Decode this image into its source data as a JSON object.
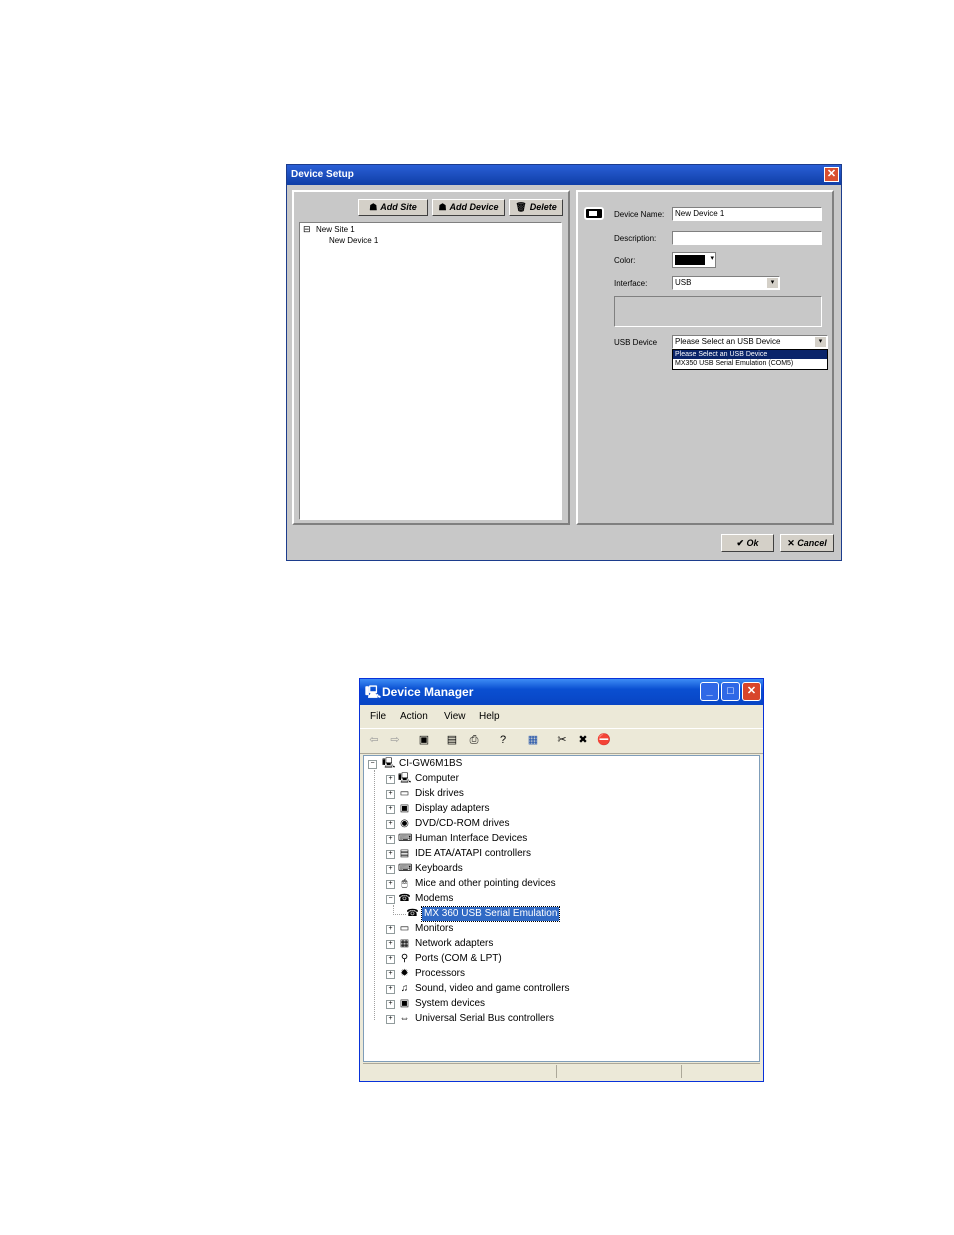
{
  "device_setup": {
    "title": "Device Setup",
    "close_glyph": "✕",
    "toolbar": {
      "add_site": "Add Site",
      "add_device": "Add Device",
      "delete": "Delete"
    },
    "tree": {
      "expander": "⊟",
      "site": "New Site 1",
      "device": "New Device 1"
    },
    "form": {
      "device_name_label": "Device Name:",
      "device_name_value": "New Device 1",
      "description_label": "Description:",
      "description_value": "",
      "color_label": "Color:",
      "color_value": "#000000",
      "interface_label": "Interface:",
      "interface_value": "USB",
      "usb_device_label": "USB Device",
      "usb_device_value": "Please Select an USB Device",
      "usb_device_options": [
        "Please Select an USB Device",
        "MX350 USB Serial Emulation (COM5)"
      ],
      "dropdown_arrow": "▾"
    },
    "buttons": {
      "ok": "Ok",
      "cancel": "Cancel"
    }
  },
  "device_manager": {
    "title": "Device Manager",
    "menu": [
      "File",
      "Action",
      "View",
      "Help"
    ],
    "window_buttons": {
      "minimize": "_",
      "maximize": "□",
      "close": "✕"
    },
    "toolbar_glyphs": [
      "⇦",
      "⇨",
      "▣",
      "▤",
      "⎙",
      "?",
      "▦",
      "✂",
      "✖",
      "⛔"
    ],
    "tree": {
      "root": "CI-GW6M1BS",
      "categories": [
        {
          "label": "Computer",
          "icon": "computer-icon",
          "expanded": false
        },
        {
          "label": "Disk drives",
          "icon": "disk-drive-icon",
          "expanded": false
        },
        {
          "label": "Display adapters",
          "icon": "display-adapter-icon",
          "expanded": false
        },
        {
          "label": "DVD/CD-ROM drives",
          "icon": "dvd-drive-icon",
          "expanded": false
        },
        {
          "label": "Human Interface Devices",
          "icon": "hid-icon",
          "expanded": false
        },
        {
          "label": "IDE ATA/ATAPI controllers",
          "icon": "ide-controller-icon",
          "expanded": false
        },
        {
          "label": "Keyboards",
          "icon": "keyboard-icon",
          "expanded": false
        },
        {
          "label": "Mice and other pointing devices",
          "icon": "mouse-icon",
          "expanded": false
        },
        {
          "label": "Modems",
          "icon": "modem-icon",
          "expanded": true
        },
        {
          "label": "Monitors",
          "icon": "monitor-icon",
          "expanded": false
        },
        {
          "label": "Network adapters",
          "icon": "network-adapter-icon",
          "expanded": false
        },
        {
          "label": "Ports (COM & LPT)",
          "icon": "port-icon",
          "expanded": false
        },
        {
          "label": "Processors",
          "icon": "processor-icon",
          "expanded": false
        },
        {
          "label": "Sound, video and game controllers",
          "icon": "sound-icon",
          "expanded": false
        },
        {
          "label": "System devices",
          "icon": "system-device-icon",
          "expanded": false
        },
        {
          "label": "Universal Serial Bus controllers",
          "icon": "usb-icon",
          "expanded": false
        }
      ],
      "modem_child": "MX 360 USB Serial Emulation"
    }
  }
}
